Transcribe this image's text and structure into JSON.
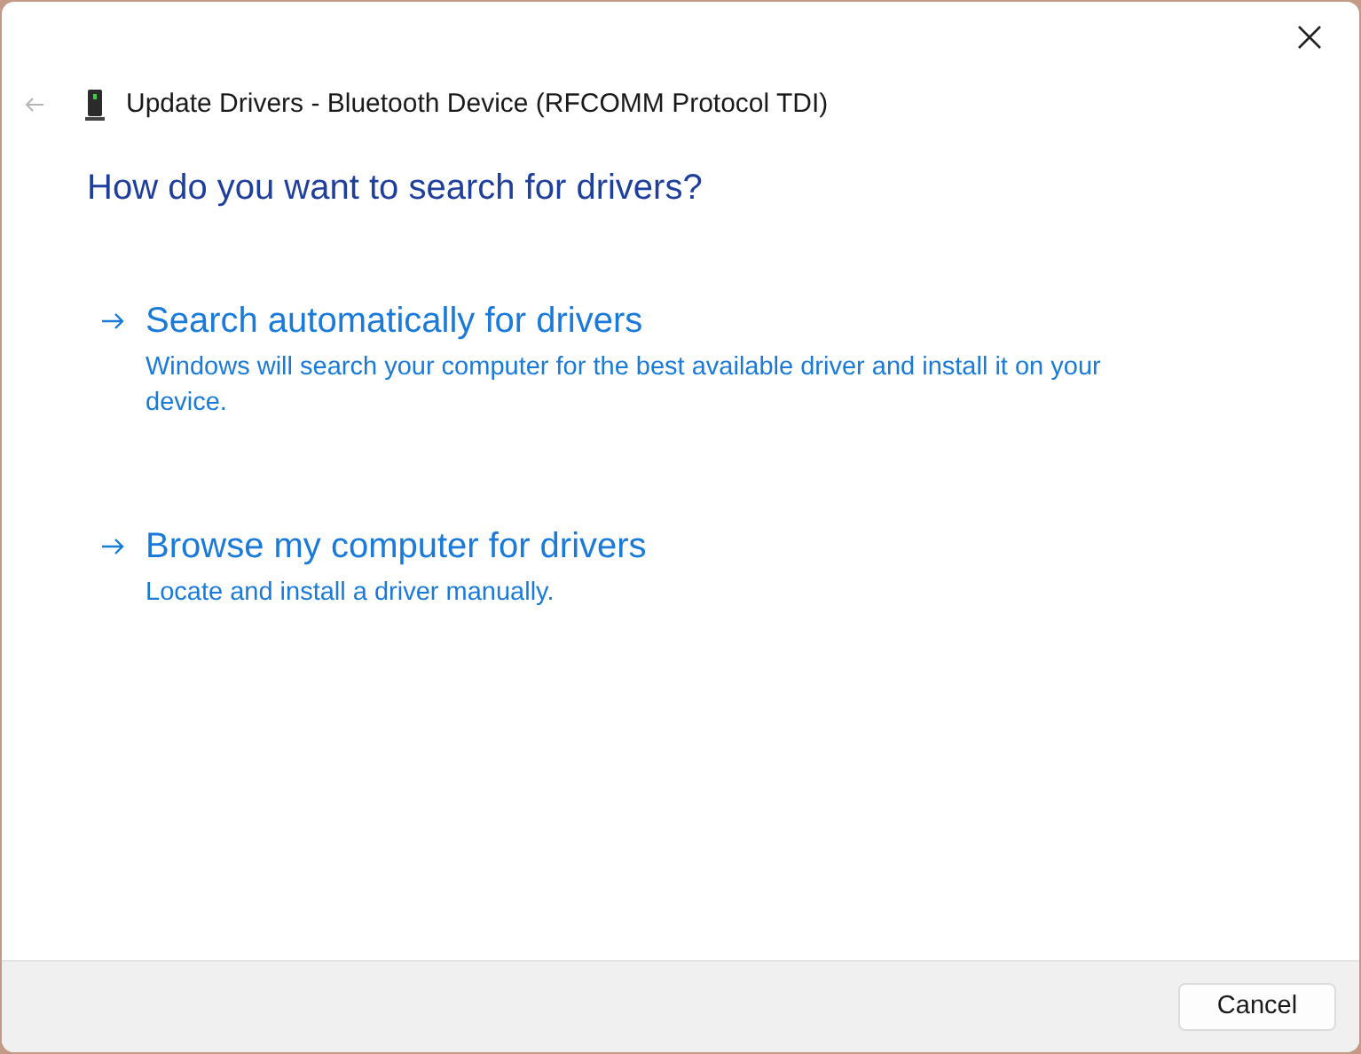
{
  "window": {
    "title": "Update Drivers - Bluetooth Device (RFCOMM Protocol TDI)"
  },
  "heading": "How do you want to search for drivers?",
  "options": [
    {
      "title": "Search automatically for drivers",
      "description": "Windows will search your computer for the best available driver and install it on your device."
    },
    {
      "title": "Browse my computer for drivers",
      "description": "Locate and install a driver manually."
    }
  ],
  "buttons": [
    "Cancel"
  ]
}
